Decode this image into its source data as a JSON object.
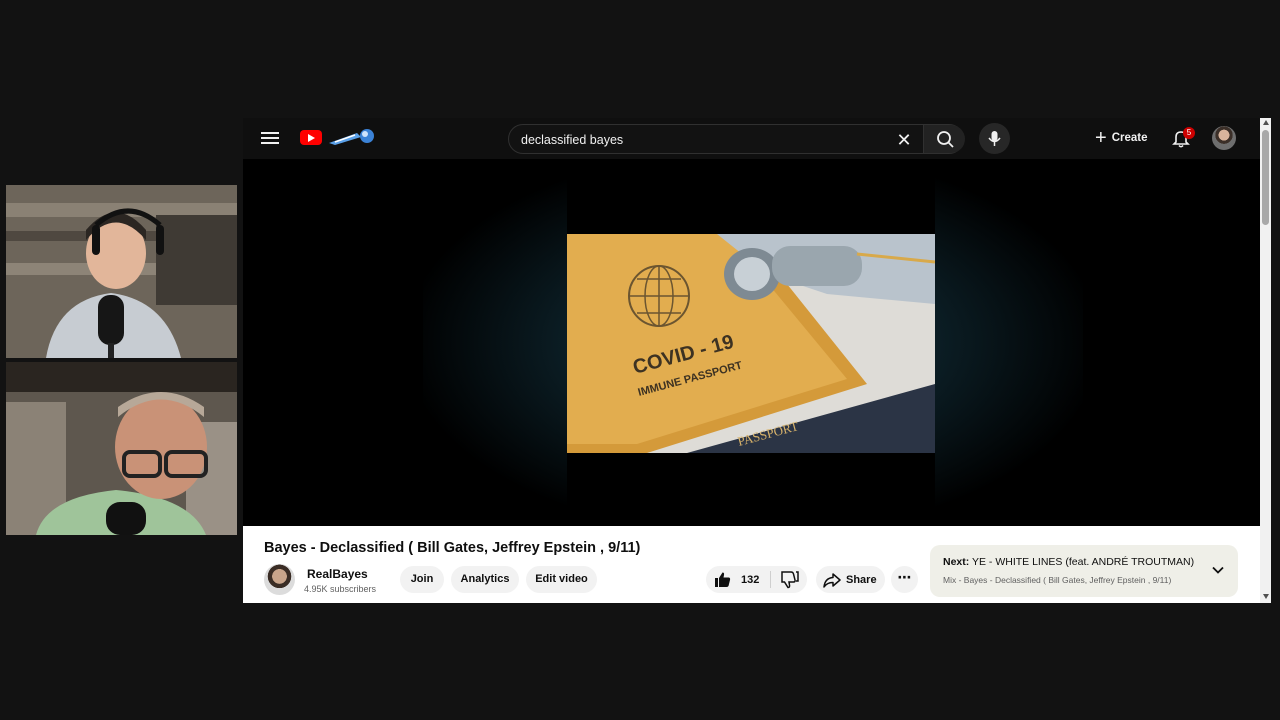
{
  "search": {
    "query": "declassified bayes"
  },
  "masthead": {
    "create_label": "Create",
    "notification_count": "5"
  },
  "video": {
    "title": "Bayes - Declassified ( Bill Gates, Jeffrey Epstein , 9/11)",
    "thumbnail": {
      "line1": "COVID - 19",
      "line2": "IMMUNE PASSPORT",
      "passport": "PASSPORT"
    }
  },
  "channel": {
    "name": "RealBayes",
    "subscribers": "4.95K subscribers"
  },
  "actions": {
    "join": "Join",
    "analytics": "Analytics",
    "edit_video": "Edit video",
    "like_count": "132",
    "share": "Share",
    "more": "⋯"
  },
  "next": {
    "label": "Next:",
    "title": "YE - WHITE LINES (feat. ANDRÉ TROUTMAN)",
    "subtitle": "Mix - Bayes - Declassified ( Bill Gates, Jeffrey Epstein , 9/11)"
  },
  "colors": {
    "brand_red": "#ff0000",
    "badge_red": "#cc0000",
    "background": "#0f0f0f"
  }
}
